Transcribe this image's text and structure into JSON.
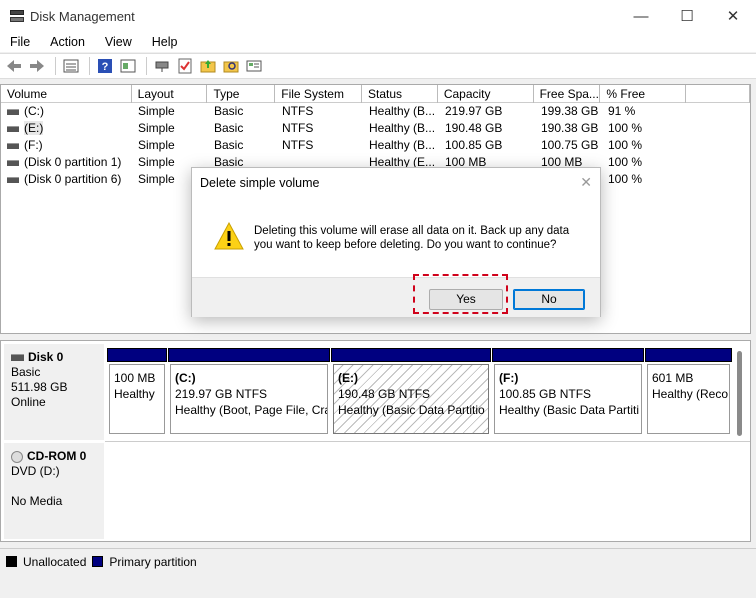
{
  "window": {
    "title": "Disk Management",
    "minimize_glyph": "—",
    "maximize_glyph": "☐",
    "close_glyph": "✕"
  },
  "menu": [
    "File",
    "Action",
    "View",
    "Help"
  ],
  "toolbar_icons": [
    "back-icon",
    "forward-icon",
    "list-icon",
    "help-icon",
    "properties-icon",
    "connect-icon",
    "check-icon",
    "folder-icon",
    "search-icon",
    "settings-icon"
  ],
  "volume_list": {
    "headers": [
      "Volume",
      "Layout",
      "Type",
      "File System",
      "Status",
      "Capacity",
      "Free Spa...",
      "% Free"
    ],
    "rows": [
      {
        "volume": "(C:)",
        "layout": "Simple",
        "type": "Basic",
        "fs": "NTFS",
        "status": "Healthy (B...",
        "capacity": "219.97 GB",
        "free": "199.38 GB",
        "pct": "91 %"
      },
      {
        "volume": "(E:)",
        "layout": "Simple",
        "type": "Basic",
        "fs": "NTFS",
        "status": "Healthy (B...",
        "capacity": "190.48 GB",
        "free": "190.38 GB",
        "pct": "100 %"
      },
      {
        "volume": "(F:)",
        "layout": "Simple",
        "type": "Basic",
        "fs": "NTFS",
        "status": "Healthy (B...",
        "capacity": "100.85 GB",
        "free": "100.75 GB",
        "pct": "100 %"
      },
      {
        "volume": "(Disk 0 partition 1)",
        "layout": "Simple",
        "type": "Basic",
        "fs": "",
        "status": "Healthy (E...",
        "capacity": "100 MB",
        "free": "100 MB",
        "pct": "100 %"
      },
      {
        "volume": "(Disk 0 partition 6)",
        "layout": "Simple",
        "type": "",
        "fs": "",
        "status": "",
        "capacity": "",
        "free": "",
        "pct": "100 %"
      }
    ]
  },
  "dialog": {
    "title": "Delete simple volume",
    "close_glyph": "✕",
    "message_line1": "Deleting this volume will erase all data on it. Back up any data",
    "message_line2": "you want to keep before deleting. Do you want to continue?",
    "yes_label": "Yes",
    "no_label": "No"
  },
  "disks": [
    {
      "name": "Disk 0",
      "type": "Basic",
      "size": "511.98 GB",
      "status": "Online",
      "partitions": [
        {
          "name": "",
          "size": "100 MB",
          "status": "Healthy"
        },
        {
          "name": "(C:)",
          "size": "219.97 GB NTFS",
          "status": "Healthy (Boot, Page File, Cra"
        },
        {
          "name": "(E:)",
          "size": "190.48 GB NTFS",
          "status": "Healthy (Basic Data Partitio"
        },
        {
          "name": "(F:)",
          "size": "100.85 GB NTFS",
          "status": "Healthy (Basic Data Partiti"
        },
        {
          "name": "",
          "size": "601 MB",
          "status": "Healthy (Reco"
        }
      ]
    },
    {
      "name": "CD-ROM 0",
      "type": "DVD (D:)",
      "size": "",
      "status": "No Media"
    }
  ],
  "legend": {
    "unallocated": "Unallocated",
    "primary": "Primary partition",
    "unallocated_color": "#000000",
    "primary_color": "#000080"
  }
}
